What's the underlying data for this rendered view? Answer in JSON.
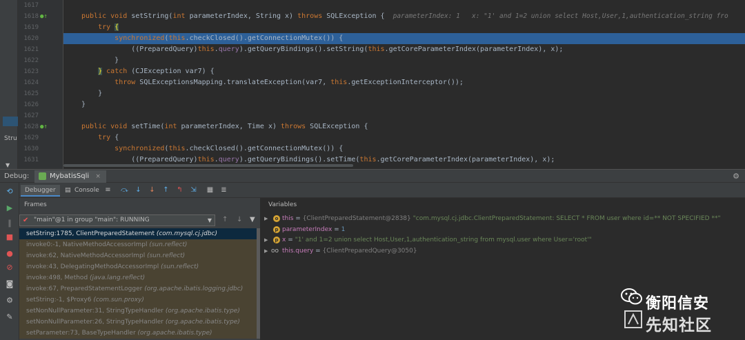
{
  "editor": {
    "left_strip_label": "Stru",
    "lines": [
      {
        "num": "1617",
        "code": [],
        "gicon": "",
        "highlight": false
      },
      {
        "num": "1618",
        "gicon": "●↑",
        "highlight": false,
        "code": [
          {
            "t": "public void ",
            "c": "kw"
          },
          {
            "t": "setString(",
            "c": ""
          },
          {
            "t": "int ",
            "c": "kw"
          },
          {
            "t": "parameterIndex, String x) ",
            "c": ""
          },
          {
            "t": "throws ",
            "c": "kw"
          },
          {
            "t": "SQLException {  ",
            "c": ""
          },
          {
            "t": "parameterIndex: 1   x: \"1' and 1=2 union select Host,User,1,authentication_string fro",
            "c": "hint"
          }
        ]
      },
      {
        "num": "1619",
        "gicon": "",
        "highlight": false,
        "code": [
          {
            "t": "    ",
            "c": ""
          },
          {
            "t": "try ",
            "c": "kw"
          },
          {
            "t": "{",
            "c": "brace-hl"
          }
        ]
      },
      {
        "num": "1620",
        "gicon": "",
        "highlight": true,
        "code": [
          {
            "t": "        ",
            "c": ""
          },
          {
            "t": "synchronized",
            "c": "kw"
          },
          {
            "t": "(",
            "c": ""
          },
          {
            "t": "this",
            "c": "kw"
          },
          {
            "t": ".checkClosed().getConnectionMutex()) {",
            "c": ""
          }
        ]
      },
      {
        "num": "1621",
        "gicon": "",
        "highlight": false,
        "code": [
          {
            "t": "            ((PreparedQuery)",
            "c": ""
          },
          {
            "t": "this",
            "c": "kw"
          },
          {
            "t": ".",
            "c": ""
          },
          {
            "t": "query",
            "c": "fld"
          },
          {
            "t": ").getQueryBindings().setString(",
            "c": ""
          },
          {
            "t": "this",
            "c": "kw"
          },
          {
            "t": ".getCoreParameterIndex(parameterIndex), x);",
            "c": ""
          }
        ]
      },
      {
        "num": "1622",
        "gicon": "",
        "highlight": false,
        "code": [
          {
            "t": "        }",
            "c": ""
          }
        ]
      },
      {
        "num": "1623",
        "gicon": "",
        "highlight": false,
        "code": [
          {
            "t": "    ",
            "c": ""
          },
          {
            "t": "}",
            "c": "brace-hl"
          },
          {
            "t": " ",
            "c": ""
          },
          {
            "t": "catch ",
            "c": "kw"
          },
          {
            "t": "(CJException var7) {",
            "c": ""
          }
        ]
      },
      {
        "num": "1624",
        "gicon": "",
        "highlight": false,
        "code": [
          {
            "t": "        ",
            "c": ""
          },
          {
            "t": "throw ",
            "c": "kw"
          },
          {
            "t": "SQLExceptionsMapping.translateException(var7, ",
            "c": ""
          },
          {
            "t": "this",
            "c": "kw"
          },
          {
            "t": ".getExceptionInterceptor());",
            "c": ""
          }
        ]
      },
      {
        "num": "1625",
        "gicon": "",
        "highlight": false,
        "code": [
          {
            "t": "    }",
            "c": ""
          }
        ]
      },
      {
        "num": "1626",
        "gicon": "",
        "highlight": false,
        "code": [
          {
            "t": "}",
            "c": ""
          }
        ]
      },
      {
        "num": "1627",
        "gicon": "",
        "highlight": false,
        "code": []
      },
      {
        "num": "1628",
        "gicon": "●↑",
        "highlight": false,
        "code": [
          {
            "t": "public void ",
            "c": "kw"
          },
          {
            "t": "setTime(",
            "c": ""
          },
          {
            "t": "int ",
            "c": "kw"
          },
          {
            "t": "parameterIndex, Time x) ",
            "c": ""
          },
          {
            "t": "throws ",
            "c": "kw"
          },
          {
            "t": "SQLException {",
            "c": ""
          }
        ]
      },
      {
        "num": "1629",
        "gicon": "",
        "highlight": false,
        "code": [
          {
            "t": "    ",
            "c": ""
          },
          {
            "t": "try ",
            "c": "kw"
          },
          {
            "t": "{",
            "c": ""
          }
        ]
      },
      {
        "num": "1630",
        "gicon": "",
        "highlight": false,
        "code": [
          {
            "t": "        ",
            "c": ""
          },
          {
            "t": "synchronized",
            "c": "kw"
          },
          {
            "t": "(",
            "c": ""
          },
          {
            "t": "this",
            "c": "kw"
          },
          {
            "t": ".checkClosed().getConnectionMutex()) {",
            "c": ""
          }
        ]
      },
      {
        "num": "1631",
        "gicon": "",
        "highlight": false,
        "code": [
          {
            "t": "            ((PreparedQuery)",
            "c": ""
          },
          {
            "t": "this",
            "c": "kw"
          },
          {
            "t": ".",
            "c": ""
          },
          {
            "t": "query",
            "c": "fld"
          },
          {
            "t": ").getQueryBindings().setTime(",
            "c": ""
          },
          {
            "t": "this",
            "c": "kw"
          },
          {
            "t": ".getCoreParameterIndex(parameterIndex), x);",
            "c": ""
          }
        ]
      }
    ]
  },
  "debug": {
    "label": "Debug:",
    "config_tab": "MybatisSqli",
    "tabs": {
      "debugger": "Debugger",
      "console": "Console"
    },
    "frames_header": "Frames",
    "thread_select": "\"main\"@1 in group \"main\": RUNNING",
    "variables_header": "Variables",
    "frames": [
      {
        "loc": "setString:1785, ClientPreparedStatement",
        "pkg": "(com.mysql.cj.jdbc)",
        "selected": true
      },
      {
        "loc": "invoke0:-1, NativeMethodAccessorImpl",
        "pkg": "(sun.reflect)",
        "selected": false
      },
      {
        "loc": "invoke:62, NativeMethodAccessorImpl",
        "pkg": "(sun.reflect)",
        "selected": false
      },
      {
        "loc": "invoke:43, DelegatingMethodAccessorImpl",
        "pkg": "(sun.reflect)",
        "selected": false
      },
      {
        "loc": "invoke:498, Method",
        "pkg": "(java.lang.reflect)",
        "selected": false
      },
      {
        "loc": "invoke:67, PreparedStatementLogger",
        "pkg": "(org.apache.ibatis.logging.jdbc)",
        "selected": false
      },
      {
        "loc": "setString:-1, $Proxy6",
        "pkg": "(com.sun.proxy)",
        "selected": false
      },
      {
        "loc": "setNonNullParameter:31, StringTypeHandler",
        "pkg": "(org.apache.ibatis.type)",
        "selected": false
      },
      {
        "loc": "setNonNullParameter:26, StringTypeHandler",
        "pkg": "(org.apache.ibatis.type)",
        "selected": false
      },
      {
        "loc": "setParameter:73, BaseTypeHandler",
        "pkg": "(org.apache.ibatis.type)",
        "selected": false
      }
    ],
    "variables": [
      {
        "expand": true,
        "icon": "badge-o",
        "name": "this",
        "eq": " = ",
        "gray": "{ClientPreparedStatement@2838} ",
        "val": "\"com.mysql.cj.jdbc.ClientPreparedStatement: SELECT * FROM user where id=** NOT SPECIFIED **\"",
        "vc": "vs"
      },
      {
        "expand": false,
        "icon": "badge-p",
        "name": "parameterIndex",
        "eq": " = ",
        "gray": "",
        "val": "1",
        "vc": "vnum"
      },
      {
        "expand": true,
        "icon": "badge-p",
        "name": "x",
        "eq": " = ",
        "gray": "",
        "val": "\"1' and 1=2 union select Host,User,1,authentication_string from mysql.user where User='root'\"",
        "vc": "vs"
      },
      {
        "expand": true,
        "icon": "oo",
        "name": "this.query",
        "eq": " = ",
        "gray": "{ClientPreparedQuery@3050}",
        "val": "",
        "vc": "vs"
      }
    ]
  },
  "watermark": {
    "line1": "衡阳信安",
    "line2": "先知社区"
  },
  "colors": {
    "highlight_line": "#2d6099",
    "selected_frame": "#0d293e",
    "keyword": "#cc7832",
    "string": "#6a8759"
  }
}
